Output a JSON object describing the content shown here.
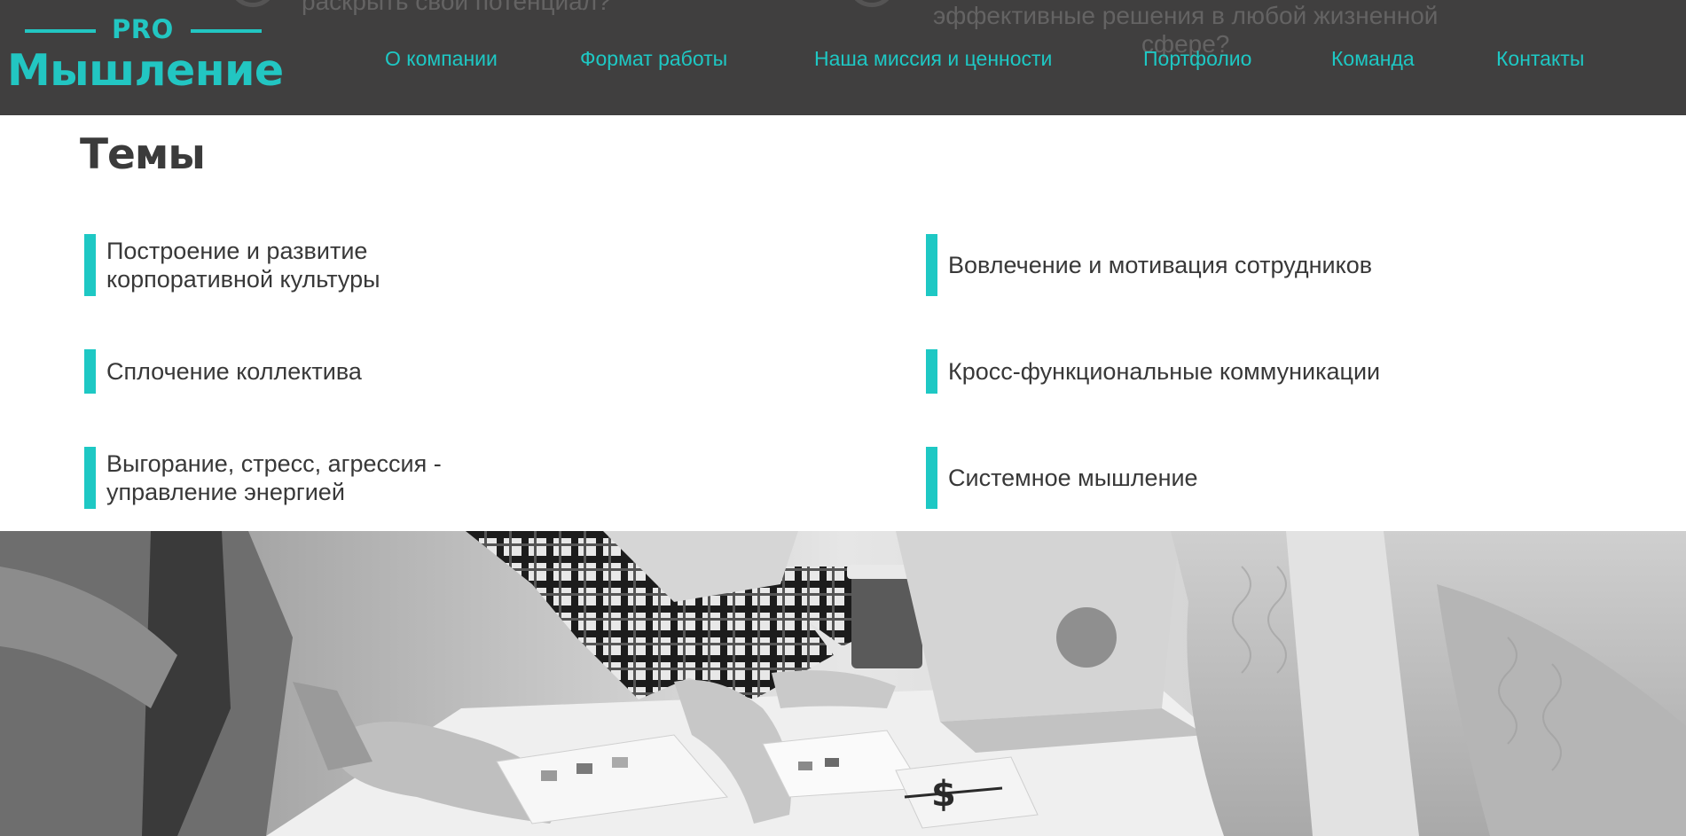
{
  "header": {
    "background_color": "#403f3f",
    "accent_color": "#1ec8c4",
    "faded_text_1": "раскрыть свой потенциал?",
    "faded_text_2_line1": "эффективные решения в любой жизненной",
    "faded_text_2_line2": "сфере?"
  },
  "logo": {
    "pro": "PRO",
    "name": "Мышление"
  },
  "nav": {
    "items": [
      {
        "label": "О компании"
      },
      {
        "label": "Формат работы"
      },
      {
        "label": "Наша миссия и ценности"
      },
      {
        "label": "Портфолио"
      },
      {
        "label": "Команда"
      },
      {
        "label": "Контакты"
      }
    ]
  },
  "themes": {
    "title": "Темы",
    "items": [
      {
        "label": "Построение и развитие\nкорпоративной культуры"
      },
      {
        "label": "Вовлечение и мотивация сотрудников"
      },
      {
        "label": "Сплочение коллектива"
      },
      {
        "label": "Кросс-функциональные коммуникации"
      },
      {
        "label": "Выгорание, стресс, агрессия -\nуправление энергией"
      },
      {
        "label": "Системное мышление"
      }
    ]
  },
  "photo": {
    "subject": "team-meeting-photo"
  }
}
